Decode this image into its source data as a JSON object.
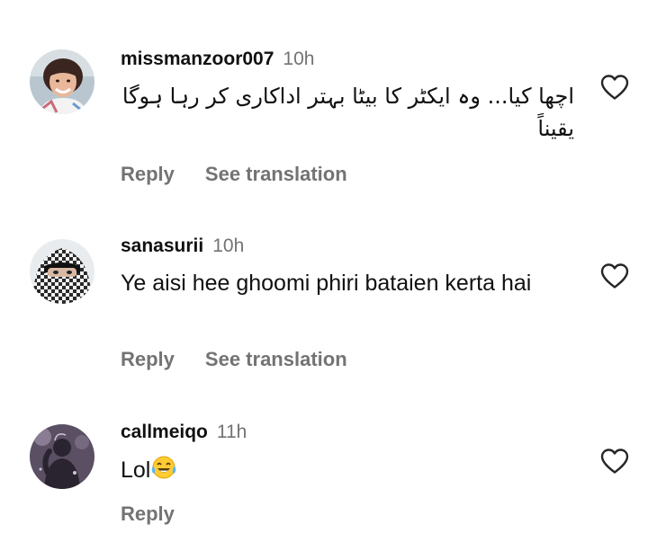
{
  "comments": [
    {
      "username": "missmanzoor007",
      "time": "10h",
      "text": "اچھا کیا... وہ ایکٹر کا بیٹا بہتر اداکاری کر رہا ہوگا یقیناً",
      "reply_label": "Reply",
      "translate_label": "See translation",
      "avatar_icon": "child-photo-avatar",
      "like_icon": "heart-outline-icon"
    },
    {
      "username": "sanasurii",
      "time": "10h",
      "text": "Ye aisi hee ghoomi phiri bataien kerta hai",
      "reply_label": "Reply",
      "translate_label": "See translation",
      "avatar_icon": "keffiyeh-photo-avatar",
      "like_icon": "heart-outline-icon"
    },
    {
      "username": "callmeiqo",
      "time": "11h",
      "text": "Lol",
      "emoji": "😂",
      "reply_label": "Reply",
      "avatar_icon": "silhouette-photo-avatar",
      "like_icon": "heart-outline-icon"
    }
  ],
  "colors": {
    "username": "#111111",
    "timestamp": "#737373",
    "action": "#737373",
    "heart_stroke": "#262626"
  }
}
